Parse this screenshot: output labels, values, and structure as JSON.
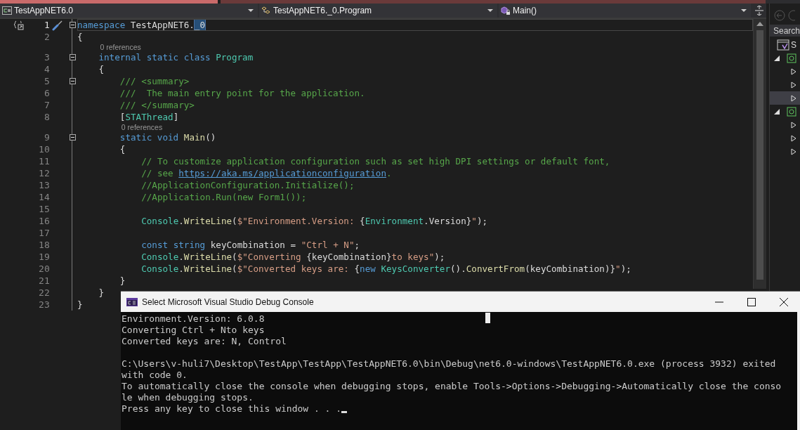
{
  "navbar": {
    "project": "TestAppNET6.0",
    "type": "TestAppNET6._0.Program",
    "member": "Main()"
  },
  "editor": {
    "lines": [
      {
        "number": "1",
        "fold": true,
        "current": true,
        "tokens": [
          {
            "kind": "keyword",
            "text": "namespace"
          },
          {
            "kind": "plain",
            "text": " TestAppNET6."
          },
          {
            "kind": "selection",
            "text": "_0"
          }
        ]
      },
      {
        "number": "2",
        "fold": false,
        "current": false,
        "tokens": [
          {
            "kind": "plain",
            "text": "{"
          }
        ]
      },
      {
        "number": "3",
        "fold": true,
        "current": false,
        "references": "0 references",
        "tokens": [
          {
            "kind": "keyword",
            "text": "    internal static class "
          },
          {
            "kind": "type",
            "text": "Program"
          }
        ]
      },
      {
        "number": "4",
        "fold": false,
        "current": false,
        "tokens": [
          {
            "kind": "plain",
            "text": "    {"
          }
        ]
      },
      {
        "number": "5",
        "fold": true,
        "current": false,
        "tokens": [
          {
            "kind": "comment",
            "text": "        /// <summary>"
          }
        ]
      },
      {
        "number": "6",
        "fold": false,
        "current": false,
        "tokens": [
          {
            "kind": "comment",
            "text": "        ///  The main entry point for the application."
          }
        ]
      },
      {
        "number": "7",
        "fold": false,
        "current": false,
        "tokens": [
          {
            "kind": "comment",
            "text": "        /// </summary>"
          }
        ]
      },
      {
        "number": "8",
        "fold": false,
        "current": false,
        "tokens": [
          {
            "kind": "plain",
            "text": "        ["
          },
          {
            "kind": "type",
            "text": "STAThread"
          },
          {
            "kind": "plain",
            "text": "]"
          }
        ]
      },
      {
        "number": "9",
        "fold": true,
        "current": false,
        "references": "0 references",
        "tokens": [
          {
            "kind": "keyword",
            "text": "        static void "
          },
          {
            "kind": "method",
            "text": "Main"
          },
          {
            "kind": "plain",
            "text": "()"
          }
        ]
      },
      {
        "number": "10",
        "fold": false,
        "current": false,
        "tokens": [
          {
            "kind": "plain",
            "text": "        {"
          }
        ]
      },
      {
        "number": "11",
        "fold": false,
        "current": false,
        "tokens": [
          {
            "kind": "comment",
            "text": "            // To customize application configuration such as set high DPI settings or default font,"
          }
        ]
      },
      {
        "number": "12",
        "fold": false,
        "current": false,
        "tokens": [
          {
            "kind": "comment",
            "text": "            // see "
          },
          {
            "kind": "link",
            "text": "https://aka.ms/applicationconfiguration"
          },
          {
            "kind": "comment",
            "text": "."
          }
        ]
      },
      {
        "number": "13",
        "fold": false,
        "current": false,
        "tokens": [
          {
            "kind": "comment",
            "text": "            //ApplicationConfiguration.Initialize();"
          }
        ]
      },
      {
        "number": "14",
        "fold": false,
        "current": false,
        "tokens": [
          {
            "kind": "comment",
            "text": "            //Application.Run(new Form1());"
          }
        ]
      },
      {
        "number": "15",
        "fold": false,
        "current": false
      },
      {
        "number": "16",
        "fold": false,
        "current": false,
        "tokens": [
          {
            "kind": "type",
            "text": "            Console"
          },
          {
            "kind": "plain",
            "text": "."
          },
          {
            "kind": "method",
            "text": "WriteLine"
          },
          {
            "kind": "plain",
            "text": "("
          },
          {
            "kind": "string",
            "text": "$\"Environment.Version: "
          },
          {
            "kind": "plain",
            "text": "{"
          },
          {
            "kind": "type",
            "text": "Environment"
          },
          {
            "kind": "plain",
            "text": ".Version}"
          },
          {
            "kind": "string",
            "text": "\""
          },
          {
            "kind": "plain",
            "text": ");"
          }
        ]
      },
      {
        "number": "17",
        "fold": false,
        "current": false
      },
      {
        "number": "18",
        "fold": false,
        "current": false,
        "tokens": [
          {
            "kind": "keyword",
            "text": "            const string "
          },
          {
            "kind": "plain",
            "text": "keyCombination = "
          },
          {
            "kind": "string",
            "text": "\"Ctrl + N\""
          },
          {
            "kind": "plain",
            "text": ";"
          }
        ]
      },
      {
        "number": "19",
        "fold": false,
        "current": false,
        "tokens": [
          {
            "kind": "type",
            "text": "            Console"
          },
          {
            "kind": "plain",
            "text": "."
          },
          {
            "kind": "method",
            "text": "WriteLine"
          },
          {
            "kind": "plain",
            "text": "("
          },
          {
            "kind": "string",
            "text": "$\"Converting "
          },
          {
            "kind": "plain",
            "text": "{keyCombination}"
          },
          {
            "kind": "string",
            "text": "to keys\""
          },
          {
            "kind": "plain",
            "text": ");"
          }
        ]
      },
      {
        "number": "20",
        "fold": false,
        "current": false,
        "tokens": [
          {
            "kind": "type",
            "text": "            Console"
          },
          {
            "kind": "plain",
            "text": "."
          },
          {
            "kind": "method",
            "text": "WriteLine"
          },
          {
            "kind": "plain",
            "text": "("
          },
          {
            "kind": "string",
            "text": "$\"Converted keys are: "
          },
          {
            "kind": "plain",
            "text": "{"
          },
          {
            "kind": "keyword",
            "text": "new "
          },
          {
            "kind": "type",
            "text": "KeysConverter"
          },
          {
            "kind": "plain",
            "text": "()."
          },
          {
            "kind": "method",
            "text": "ConvertFrom"
          },
          {
            "kind": "plain",
            "text": "(keyCombination)}"
          },
          {
            "kind": "string",
            "text": "\""
          },
          {
            "kind": "plain",
            "text": ");"
          }
        ]
      },
      {
        "number": "21",
        "fold": false,
        "current": false,
        "tokens": [
          {
            "kind": "plain",
            "text": "        }"
          }
        ]
      },
      {
        "number": "22",
        "fold": false,
        "current": false,
        "tokens": [
          {
            "kind": "plain",
            "text": "    }"
          }
        ]
      },
      {
        "number": "23",
        "fold": false,
        "current": false,
        "tokens": [
          {
            "kind": "plain",
            "text": "}"
          }
        ]
      }
    ]
  },
  "solution_explorer": {
    "search": {
      "placeholder": "Search"
    },
    "tree": [
      {
        "label": "S",
        "selected": false,
        "children": [
          {
            "expanded": true,
            "selected": false,
            "children": [
              {
                "expanded": false,
                "selected": false
              },
              {
                "expanded": false,
                "selected": false
              },
              {
                "expanded": false,
                "selected": true
              }
            ]
          },
          {
            "expanded": true,
            "selected": false,
            "children": [
              {
                "expanded": false,
                "selected": false
              },
              {
                "expanded": false,
                "selected": false
              },
              {
                "expanded": false,
                "selected": false
              }
            ]
          }
        ]
      }
    ]
  },
  "console": {
    "title": "Select Microsoft Visual Studio Debug Console",
    "output": [
      "Environment.Version: 6.0.8",
      "Converting Ctrl + Nto keys",
      "Converted keys are: N, Control"
    ],
    "messages": [
      "C:\\Users\\v-huli7\\Desktop\\TestApp\\TestApp\\TestAppNET6.0\\bin\\Debug\\net6.0-windows\\TestAppNET6.0.exe (process 3932) exited",
      "with code 0.",
      "To automatically close the console when debugging stops, enable Tools->Options->Debugging->Automatically close the conso",
      "le when debugging stops.",
      "Press any key to close this window . . ."
    ]
  }
}
